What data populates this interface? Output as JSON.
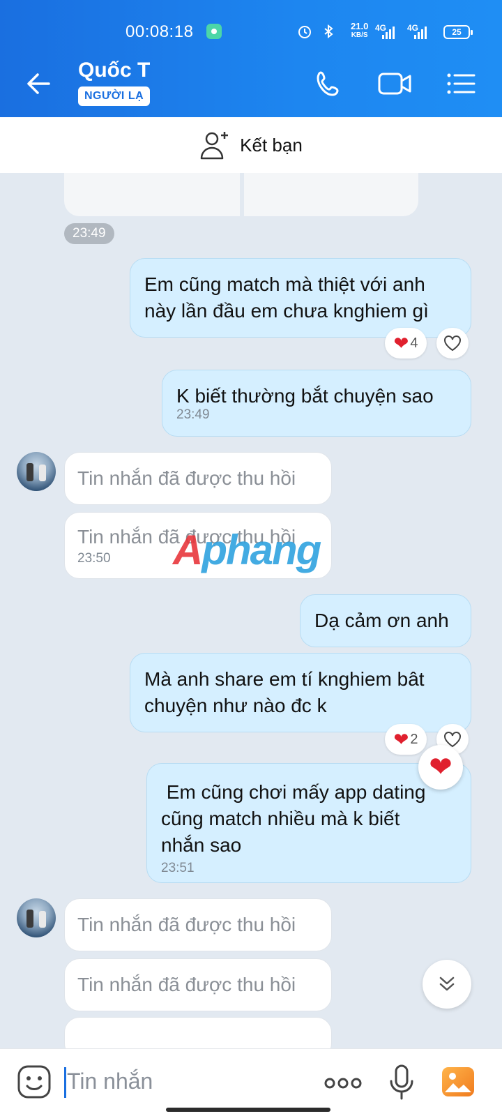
{
  "status_bar": {
    "time": "00:08:18",
    "speed_value": "21.0",
    "speed_unit": "KB/S",
    "net1": "4G",
    "net2": "4G",
    "battery": "25"
  },
  "header": {
    "title": "Quốc T",
    "badge": "NGƯỜI LẠ"
  },
  "add_friend": {
    "label": "Kết bạn"
  },
  "messages": [
    {
      "side": "them",
      "type": "timestamp",
      "time": "23:49"
    },
    {
      "side": "me",
      "text_lines": [
        "Em cũng match mà thiệt với anh",
        "này lần đầu em chưa knghiem gì"
      ],
      "reaction_count": "4"
    },
    {
      "side": "me",
      "text": "K biết thường bắt chuyện sao",
      "time": "23:49"
    },
    {
      "side": "them",
      "text": "Tin nhắn đã được thu hồi"
    },
    {
      "side": "them",
      "text": "Tin nhắn đã được thu hồi",
      "time": "23:50"
    },
    {
      "side": "me",
      "text": "Dạ cảm ơn anh"
    },
    {
      "side": "me",
      "text_lines": [
        "Mà anh share em tí knghiem bât",
        "chuyện như nào đc k"
      ],
      "reaction_count": "2"
    },
    {
      "side": "me",
      "text_lines": [
        " Em cũng chơi mấy app dating",
        "cũng match nhiều mà k biết",
        "nhắn sao"
      ],
      "time": "23:51"
    },
    {
      "side": "them",
      "text": "Tin nhắn đã được thu hồi"
    },
    {
      "side": "them",
      "text": "Tin nhắn đã được thu hồi"
    }
  ],
  "watermark": {
    "part1": "A",
    "part2": "phang"
  },
  "input": {
    "placeholder": "Tin nhắn"
  },
  "colors": {
    "accent": "#1a6fe0",
    "my_bubble": "#d5efff",
    "heart": "#e0202e"
  }
}
